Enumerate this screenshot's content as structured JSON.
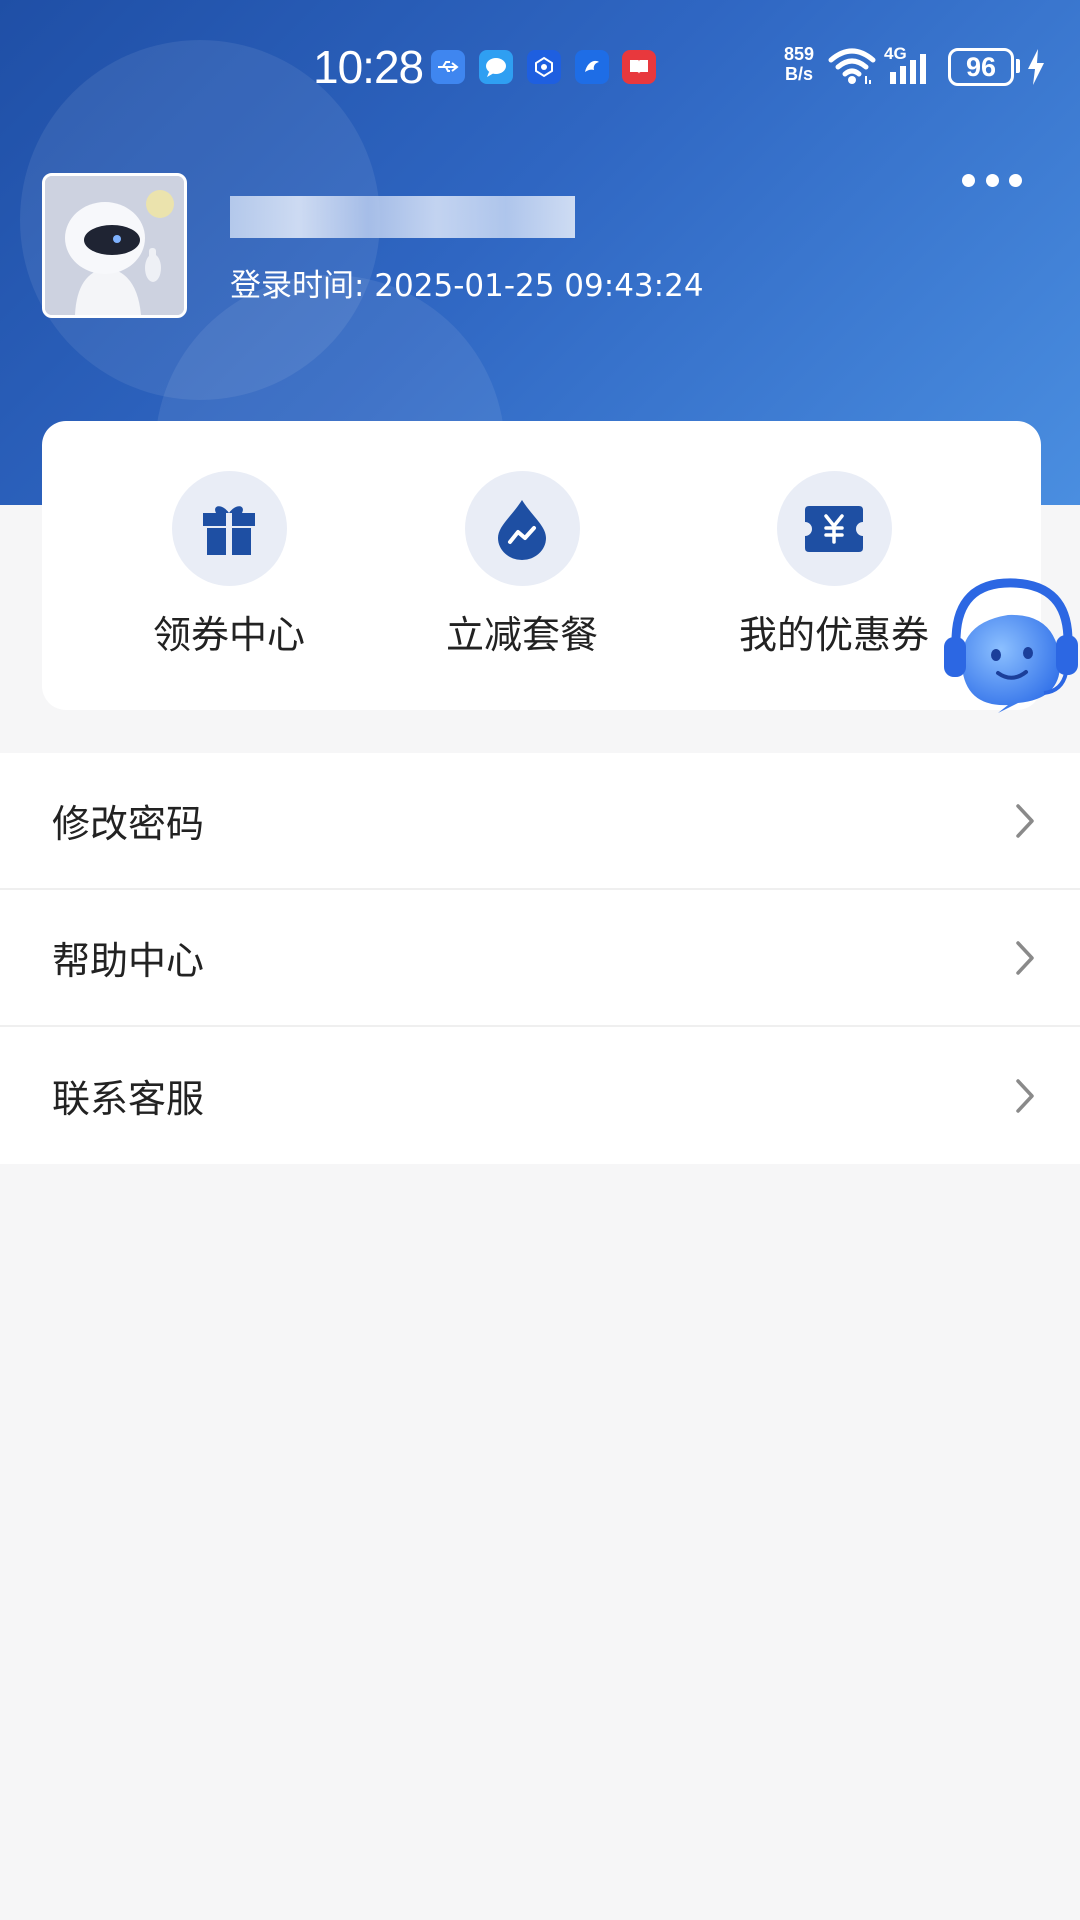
{
  "status_bar": {
    "time": "10:28",
    "net_speed_value": "859",
    "net_speed_unit": "B/s",
    "network_type": "4G",
    "battery": "96"
  },
  "profile": {
    "login_time": "登录时间: 2025-01-25 09:43:24"
  },
  "quick_actions": [
    {
      "label": "领券中心",
      "icon": "gift-icon"
    },
    {
      "label": "立减套餐",
      "icon": "trend-drop-icon"
    },
    {
      "label": "我的优惠券",
      "icon": "coupon-icon"
    }
  ],
  "menu": [
    {
      "label": "修改密码"
    },
    {
      "label": "帮助中心"
    },
    {
      "label": "联系客服"
    }
  ],
  "colors": {
    "header_start": "#1f4fa6",
    "header_end": "#4a8ee0",
    "icon_blue": "#1e4fa3",
    "icon_circle": "#e9edf6"
  }
}
